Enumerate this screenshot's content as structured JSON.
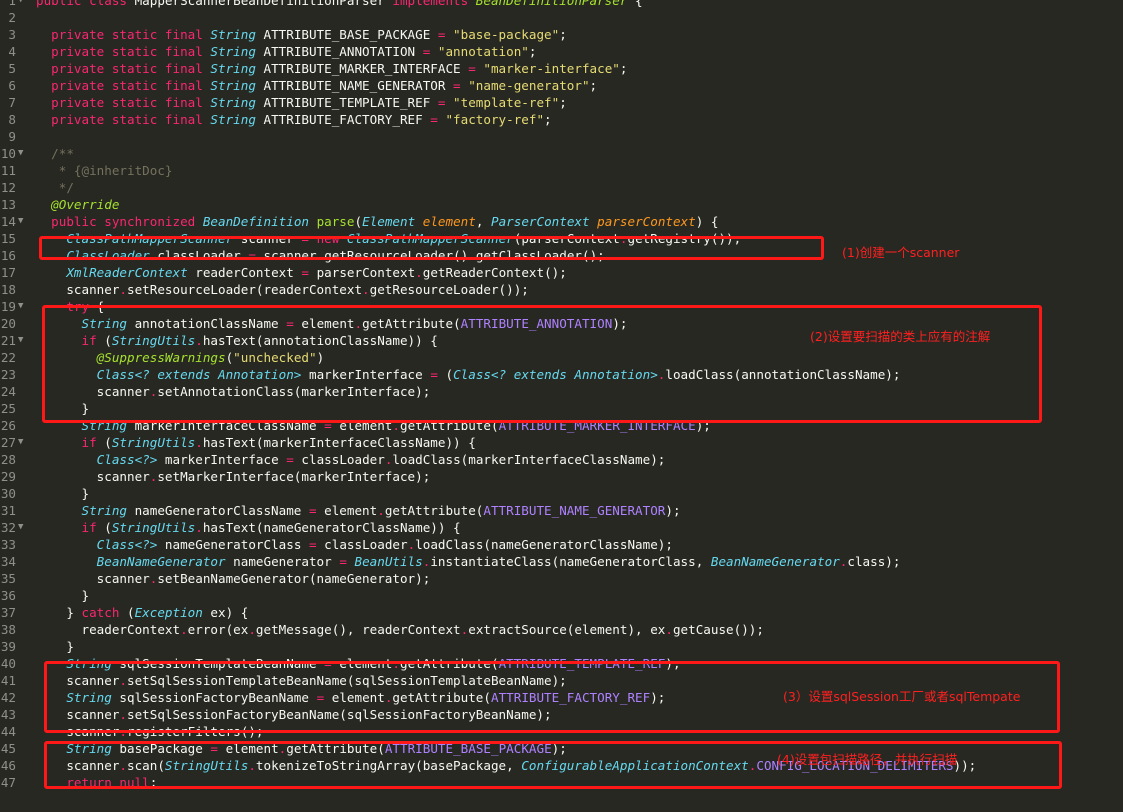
{
  "lines": [
    {
      "n": "1",
      "f": "▼",
      "t": [
        [
          "kw",
          "public class "
        ],
        [
          "",
          "MapperScannerBeanDefinitionParser "
        ],
        [
          "kw",
          "implements "
        ],
        [
          "cls",
          "BeanDefinitionParser"
        ],
        [
          "",
          " {"
        ]
      ]
    },
    {
      "n": "2",
      "f": "",
      "t": []
    },
    {
      "n": "3",
      "f": "",
      "t": [
        [
          "",
          "  "
        ],
        [
          "kw",
          "private static final "
        ],
        [
          "ty",
          "String "
        ],
        [
          "",
          "ATTRIBUTE_BASE_PACKAGE "
        ],
        [
          "op",
          "= "
        ],
        [
          "st",
          "\"base-package\""
        ],
        [
          "",
          ";"
        ]
      ]
    },
    {
      "n": "4",
      "f": "",
      "t": [
        [
          "",
          "  "
        ],
        [
          "kw",
          "private static final "
        ],
        [
          "ty",
          "String "
        ],
        [
          "",
          "ATTRIBUTE_ANNOTATION "
        ],
        [
          "op",
          "= "
        ],
        [
          "st",
          "\"annotation\""
        ],
        [
          "",
          ";"
        ]
      ]
    },
    {
      "n": "5",
      "f": "",
      "t": [
        [
          "",
          "  "
        ],
        [
          "kw",
          "private static final "
        ],
        [
          "ty",
          "String "
        ],
        [
          "",
          "ATTRIBUTE_MARKER_INTERFACE "
        ],
        [
          "op",
          "= "
        ],
        [
          "st",
          "\"marker-interface\""
        ],
        [
          "",
          ";"
        ]
      ]
    },
    {
      "n": "6",
      "f": "",
      "t": [
        [
          "",
          "  "
        ],
        [
          "kw",
          "private static final "
        ],
        [
          "ty",
          "String "
        ],
        [
          "",
          "ATTRIBUTE_NAME_GENERATOR "
        ],
        [
          "op",
          "= "
        ],
        [
          "st",
          "\"name-generator\""
        ],
        [
          "",
          ";"
        ]
      ]
    },
    {
      "n": "7",
      "f": "",
      "t": [
        [
          "",
          "  "
        ],
        [
          "kw",
          "private static final "
        ],
        [
          "ty",
          "String "
        ],
        [
          "",
          "ATTRIBUTE_TEMPLATE_REF "
        ],
        [
          "op",
          "= "
        ],
        [
          "st",
          "\"template-ref\""
        ],
        [
          "",
          ";"
        ]
      ]
    },
    {
      "n": "8",
      "f": "",
      "t": [
        [
          "",
          "  "
        ],
        [
          "kw",
          "private static final "
        ],
        [
          "ty",
          "String "
        ],
        [
          "",
          "ATTRIBUTE_FACTORY_REF "
        ],
        [
          "op",
          "= "
        ],
        [
          "st",
          "\"factory-ref\""
        ],
        [
          "",
          ";"
        ]
      ]
    },
    {
      "n": "9",
      "f": "",
      "t": []
    },
    {
      "n": "10",
      "f": "▼",
      "t": [
        [
          "",
          "  "
        ],
        [
          "cm",
          "/**"
        ]
      ]
    },
    {
      "n": "11",
      "f": "",
      "t": [
        [
          "",
          "   "
        ],
        [
          "cm",
          "* {@inheritDoc}"
        ]
      ]
    },
    {
      "n": "12",
      "f": "",
      "t": [
        [
          "",
          "   "
        ],
        [
          "cm",
          "*/"
        ]
      ]
    },
    {
      "n": "13",
      "f": "",
      "t": [
        [
          "",
          "  "
        ],
        [
          "an",
          "@Override"
        ]
      ]
    },
    {
      "n": "14",
      "f": "▼",
      "t": [
        [
          "",
          "  "
        ],
        [
          "kw",
          "public synchronized "
        ],
        [
          "ty",
          "BeanDefinition "
        ],
        [
          "fn",
          "parse"
        ],
        [
          "",
          "("
        ],
        [
          "ty",
          "Element "
        ],
        [
          "pa",
          "element"
        ],
        [
          "",
          ", "
        ],
        [
          "ty",
          "ParserContext "
        ],
        [
          "pa",
          "parserContext"
        ],
        [
          "",
          ") {"
        ]
      ]
    },
    {
      "n": "15",
      "f": "",
      "t": [
        [
          "",
          "    "
        ],
        [
          "ty",
          "ClassPathMapperScanner "
        ],
        [
          "",
          "scanner "
        ],
        [
          "op",
          "= "
        ],
        [
          "kw",
          "new "
        ],
        [
          "ty",
          "ClassPathMapperScanner"
        ],
        [
          "",
          "(parserContext"
        ],
        [
          "op",
          "."
        ],
        [
          "",
          "getRegistry());"
        ]
      ]
    },
    {
      "n": "16",
      "f": "",
      "t": [
        [
          "",
          "    "
        ],
        [
          "ty",
          "ClassLoader "
        ],
        [
          "",
          "classLoader "
        ],
        [
          "op",
          "= "
        ],
        [
          "",
          "scanner"
        ],
        [
          "op",
          "."
        ],
        [
          "",
          "getResourceLoader()"
        ],
        [
          "op",
          "."
        ],
        [
          "",
          "getClassLoader();"
        ]
      ]
    },
    {
      "n": "17",
      "f": "",
      "t": [
        [
          "",
          "    "
        ],
        [
          "ty",
          "XmlReaderContext "
        ],
        [
          "",
          "readerContext "
        ],
        [
          "op",
          "= "
        ],
        [
          "",
          "parserContext"
        ],
        [
          "op",
          "."
        ],
        [
          "",
          "getReaderContext();"
        ]
      ]
    },
    {
      "n": "18",
      "f": "",
      "t": [
        [
          "",
          "    scanner"
        ],
        [
          "op",
          "."
        ],
        [
          "",
          "setResourceLoader(readerContext"
        ],
        [
          "op",
          "."
        ],
        [
          "",
          "getResourceLoader());"
        ]
      ]
    },
    {
      "n": "19",
      "f": "▼",
      "t": [
        [
          "",
          "    "
        ],
        [
          "kw",
          "try"
        ],
        [
          "",
          " {"
        ]
      ]
    },
    {
      "n": "20",
      "f": "",
      "t": [
        [
          "",
          "      "
        ],
        [
          "ty",
          "String "
        ],
        [
          "",
          "annotationClassName "
        ],
        [
          "op",
          "= "
        ],
        [
          "",
          "element"
        ],
        [
          "op",
          "."
        ],
        [
          "",
          "getAttribute("
        ],
        [
          "cn",
          "ATTRIBUTE_ANNOTATION"
        ],
        [
          "",
          ");"
        ]
      ]
    },
    {
      "n": "21",
      "f": "▼",
      "t": [
        [
          "",
          "      "
        ],
        [
          "kw",
          "if "
        ],
        [
          "",
          "("
        ],
        [
          "ty",
          "StringUtils"
        ],
        [
          "op",
          "."
        ],
        [
          "",
          "hasText(annotationClassName)) {"
        ]
      ]
    },
    {
      "n": "22",
      "f": "",
      "t": [
        [
          "",
          "        "
        ],
        [
          "an",
          "@SuppressWarnings"
        ],
        [
          "",
          "("
        ],
        [
          "st",
          "\"unchecked\""
        ],
        [
          "",
          ")"
        ]
      ]
    },
    {
      "n": "23",
      "f": "",
      "t": [
        [
          "",
          "        "
        ],
        [
          "ty",
          "Class<? extends Annotation> "
        ],
        [
          "",
          "markerInterface "
        ],
        [
          "op",
          "= "
        ],
        [
          "",
          "("
        ],
        [
          "ty",
          "Class<? extends Annotation>"
        ],
        [
          ") classLoader"
        ],
        [
          "op",
          "."
        ],
        [
          "",
          "loadClass(annotationClassName);"
        ]
      ]
    },
    {
      "n": "24",
      "f": "",
      "t": [
        [
          "",
          "        scanner"
        ],
        [
          "op",
          "."
        ],
        [
          "",
          "setAnnotationClass(markerInterface);"
        ]
      ]
    },
    {
      "n": "25",
      "f": "",
      "t": [
        [
          "",
          "      }"
        ]
      ]
    },
    {
      "n": "26",
      "f": "",
      "t": [
        [
          "",
          "      "
        ],
        [
          "ty",
          "String "
        ],
        [
          "",
          "markerInterfaceClassName "
        ],
        [
          "op",
          "= "
        ],
        [
          "",
          "element"
        ],
        [
          "op",
          "."
        ],
        [
          "",
          "getAttribute("
        ],
        [
          "cn",
          "ATTRIBUTE_MARKER_INTERFACE"
        ],
        [
          "",
          ");"
        ]
      ]
    },
    {
      "n": "27",
      "f": "▼",
      "t": [
        [
          "",
          "      "
        ],
        [
          "kw",
          "if "
        ],
        [
          "",
          "("
        ],
        [
          "ty",
          "StringUtils"
        ],
        [
          "op",
          "."
        ],
        [
          "",
          "hasText(markerInterfaceClassName)) {"
        ]
      ]
    },
    {
      "n": "28",
      "f": "",
      "t": [
        [
          "",
          "        "
        ],
        [
          "ty",
          "Class<?> "
        ],
        [
          "",
          "markerInterface "
        ],
        [
          "op",
          "= "
        ],
        [
          "",
          "classLoader"
        ],
        [
          "op",
          "."
        ],
        [
          "",
          "loadClass(markerInterfaceClassName);"
        ]
      ]
    },
    {
      "n": "29",
      "f": "",
      "t": [
        [
          "",
          "        scanner"
        ],
        [
          "op",
          "."
        ],
        [
          "",
          "setMarkerInterface(markerInterface);"
        ]
      ]
    },
    {
      "n": "30",
      "f": "",
      "t": [
        [
          "",
          "      }"
        ]
      ]
    },
    {
      "n": "31",
      "f": "",
      "t": [
        [
          "",
          "      "
        ],
        [
          "ty",
          "String "
        ],
        [
          "",
          "nameGeneratorClassName "
        ],
        [
          "op",
          "= "
        ],
        [
          "",
          "element"
        ],
        [
          "op",
          "."
        ],
        [
          "",
          "getAttribute("
        ],
        [
          "cn",
          "ATTRIBUTE_NAME_GENERATOR"
        ],
        [
          "",
          ");"
        ]
      ]
    },
    {
      "n": "32",
      "f": "▼",
      "t": [
        [
          "",
          "      "
        ],
        [
          "kw",
          "if "
        ],
        [
          "",
          "("
        ],
        [
          "ty",
          "StringUtils"
        ],
        [
          "op",
          "."
        ],
        [
          "",
          "hasText(nameGeneratorClassName)) {"
        ]
      ]
    },
    {
      "n": "33",
      "f": "",
      "t": [
        [
          "",
          "        "
        ],
        [
          "ty",
          "Class<?> "
        ],
        [
          "",
          "nameGeneratorClass "
        ],
        [
          "op",
          "= "
        ],
        [
          "",
          "classLoader"
        ],
        [
          "op",
          "."
        ],
        [
          "",
          "loadClass(nameGeneratorClassName);"
        ]
      ]
    },
    {
      "n": "34",
      "f": "",
      "t": [
        [
          "",
          "        "
        ],
        [
          "ty",
          "BeanNameGenerator "
        ],
        [
          "",
          "nameGenerator "
        ],
        [
          "op",
          "= "
        ],
        [
          "ty",
          "BeanUtils"
        ],
        [
          "op",
          "."
        ],
        [
          "",
          "instantiateClass(nameGeneratorClass, "
        ],
        [
          "ty",
          "BeanNameGenerator"
        ],
        [
          "op",
          "."
        ],
        [
          "",
          "class);"
        ]
      ]
    },
    {
      "n": "35",
      "f": "",
      "t": [
        [
          "",
          "        scanner"
        ],
        [
          "op",
          "."
        ],
        [
          "",
          "setBeanNameGenerator(nameGenerator);"
        ]
      ]
    },
    {
      "n": "36",
      "f": "",
      "t": [
        [
          "",
          "      }"
        ]
      ]
    },
    {
      "n": "37",
      "f": "",
      "t": [
        [
          "",
          "    } "
        ],
        [
          "kw",
          "catch "
        ],
        [
          "",
          "("
        ],
        [
          "ty",
          "Exception "
        ],
        [
          "",
          "ex) {"
        ]
      ]
    },
    {
      "n": "38",
      "f": "",
      "t": [
        [
          "",
          "      readerContext"
        ],
        [
          "op",
          "."
        ],
        [
          "",
          "error(ex"
        ],
        [
          "op",
          "."
        ],
        [
          "",
          "getMessage(), readerContext"
        ],
        [
          "op",
          "."
        ],
        [
          "",
          "extractSource(element), ex"
        ],
        [
          "op",
          "."
        ],
        [
          "",
          "getCause());"
        ]
      ]
    },
    {
      "n": "39",
      "f": "",
      "t": [
        [
          "",
          "    }"
        ]
      ]
    },
    {
      "n": "40",
      "f": "",
      "t": [
        [
          "",
          "    "
        ],
        [
          "ty",
          "String "
        ],
        [
          "",
          "sqlSessionTemplateBeanName "
        ],
        [
          "op",
          "= "
        ],
        [
          "",
          "element"
        ],
        [
          "op",
          "."
        ],
        [
          "",
          "getAttribute("
        ],
        [
          "cn",
          "ATTRIBUTE_TEMPLATE_REF"
        ],
        [
          "",
          ");"
        ]
      ]
    },
    {
      "n": "41",
      "f": "",
      "t": [
        [
          "",
          "    scanner"
        ],
        [
          "op",
          "."
        ],
        [
          "",
          "setSqlSessionTemplateBeanName(sqlSessionTemplateBeanName);"
        ]
      ]
    },
    {
      "n": "42",
      "f": "",
      "t": [
        [
          "",
          "    "
        ],
        [
          "ty",
          "String "
        ],
        [
          "",
          "sqlSessionFactoryBeanName "
        ],
        [
          "op",
          "= "
        ],
        [
          "",
          "element"
        ],
        [
          "op",
          "."
        ],
        [
          "",
          "getAttribute("
        ],
        [
          "cn",
          "ATTRIBUTE_FACTORY_REF"
        ],
        [
          "",
          ");"
        ]
      ]
    },
    {
      "n": "43",
      "f": "",
      "t": [
        [
          "",
          "    scanner"
        ],
        [
          "op",
          "."
        ],
        [
          "",
          "setSqlSessionFactoryBeanName(sqlSessionFactoryBeanName);"
        ]
      ]
    },
    {
      "n": "44",
      "f": "",
      "t": [
        [
          "",
          "    scanner"
        ],
        [
          "op",
          "."
        ],
        [
          "",
          "registerFilters();"
        ]
      ]
    },
    {
      "n": "45",
      "f": "",
      "t": [
        [
          "",
          "    "
        ],
        [
          "ty",
          "String "
        ],
        [
          "",
          "basePackage "
        ],
        [
          "op",
          "= "
        ],
        [
          "",
          "element"
        ],
        [
          "op",
          "."
        ],
        [
          "",
          "getAttribute("
        ],
        [
          "cn",
          "ATTRIBUTE_BASE_PACKAGE"
        ],
        [
          "",
          ");"
        ]
      ]
    },
    {
      "n": "46",
      "f": "",
      "t": [
        [
          "",
          "    scanner"
        ],
        [
          "op",
          "."
        ],
        [
          "",
          "scan("
        ],
        [
          "ty",
          "StringUtils"
        ],
        [
          "op",
          "."
        ],
        [
          "",
          "tokenizeToStringArray(basePackage, "
        ],
        [
          "ty",
          "ConfigurableApplicationContext"
        ],
        [
          "op",
          "."
        ],
        [
          "cn",
          "CONFIG_LOCATION_DELIMITERS"
        ],
        [
          "",
          "));"
        ]
      ]
    },
    {
      "n": "47",
      "f": "",
      "t": [
        [
          "",
          "    "
        ],
        [
          "kw",
          "return "
        ],
        [
          "kw",
          "null"
        ],
        [
          "",
          ";"
        ]
      ]
    }
  ],
  "annotations": {
    "note1": "(1)创建一个scanner",
    "note2": "(2)设置要扫描的类上应有的注解",
    "note3": "(3）设置sqlSession工厂或者sqlTempate",
    "note4": "(4)设置包扫描路径，并执行扫描"
  },
  "colors": {
    "background": "#272822",
    "highlight_box": "#ff1818"
  }
}
